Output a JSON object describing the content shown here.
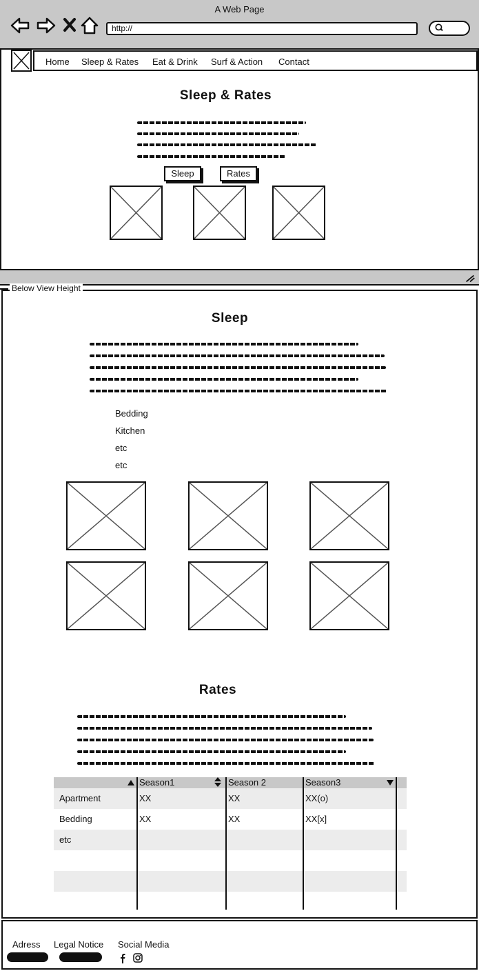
{
  "window": {
    "title": "A Web Page",
    "url": "http://"
  },
  "nav": {
    "items": [
      {
        "label": "Home"
      },
      {
        "label": "Sleep & Rates"
      },
      {
        "label": "Eat & Drink"
      },
      {
        "label": "Surf & Action"
      },
      {
        "label": "Contact"
      }
    ]
  },
  "hero": {
    "title": "Sleep & Rates",
    "buttons": [
      {
        "label": "Sleep"
      },
      {
        "label": "Rates"
      }
    ]
  },
  "below_fold_label": "Below View Height",
  "sleep": {
    "title": "Sleep",
    "amenities": [
      "Bedding",
      "Kitchen",
      "etc",
      "etc"
    ]
  },
  "rates": {
    "title": "Rates",
    "table": {
      "headers": [
        "",
        "Season1",
        "Season 2",
        "Season3"
      ],
      "rows": [
        [
          "Apartment",
          "XX",
          "XX",
          "XX(o)"
        ],
        [
          "Bedding",
          "XX",
          "XX",
          "XX[x]"
        ],
        [
          "etc",
          "",
          "",
          ""
        ],
        [
          "",
          "",
          "",
          ""
        ],
        [
          "",
          "",
          "",
          ""
        ]
      ]
    }
  },
  "footer": {
    "address_label": "Adress",
    "legal_label": "Legal Notice",
    "social_label": "Social Media",
    "social_icons": [
      "facebook-icon",
      "instagram-icon"
    ]
  }
}
